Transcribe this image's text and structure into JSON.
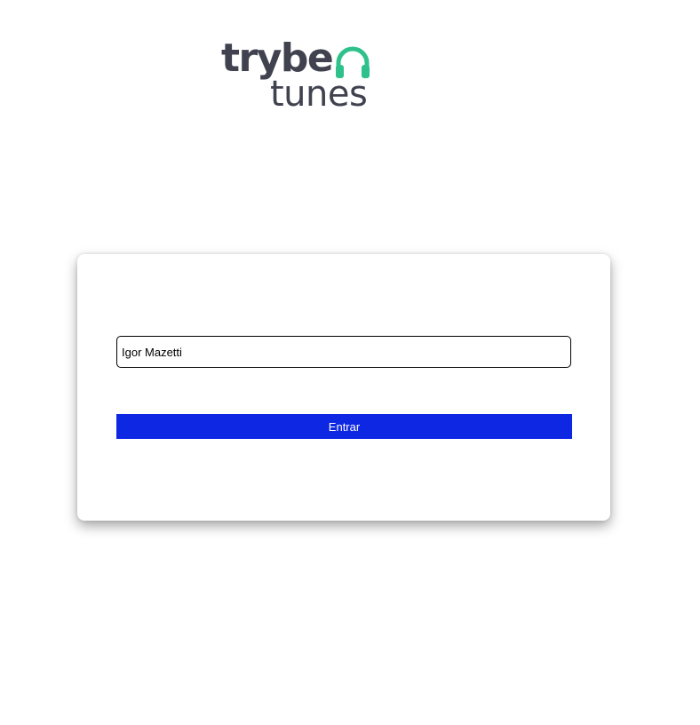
{
  "logo": {
    "brand": "trybe",
    "sub": "tunes",
    "icon": "headphones-icon",
    "text_color": "#40434f",
    "icon_color": "#2fc18c"
  },
  "login": {
    "name_value": "Igor Mazetti",
    "button_label": "Entrar",
    "button_color": "#0e27e3"
  }
}
